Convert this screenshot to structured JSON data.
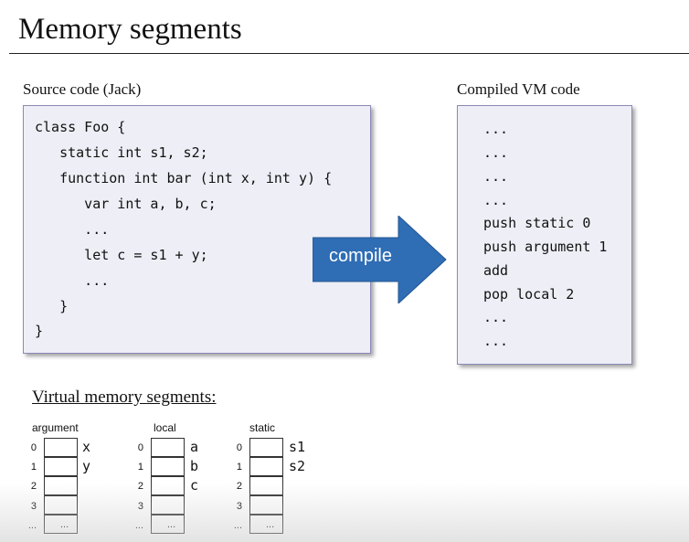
{
  "title": "Memory segments",
  "source": {
    "label": "Source code (Jack)",
    "lines": [
      "class Foo {",
      "   static int s1, s2;",
      "   function int bar (int x, int y) {",
      "      var int a, b, c;",
      "      ...",
      "      let c = s1 + y;",
      "      ...",
      "   }",
      "}"
    ]
  },
  "compile_label": "compile",
  "compiled": {
    "label": "Compiled VM code",
    "lines": [
      "...",
      "...",
      "...",
      "...",
      "push static 0",
      "push argument 1",
      "add",
      "pop local 2",
      "...",
      "..."
    ]
  },
  "virtual_heading": "Virtual memory segments:",
  "segments": [
    {
      "name": "argument",
      "indices": [
        "0",
        "1",
        "2",
        "3",
        "..."
      ],
      "cell_text": [
        "",
        "",
        "",
        "",
        "..."
      ],
      "vars": [
        "x",
        "y"
      ]
    },
    {
      "name": "local",
      "indices": [
        "0",
        "1",
        "2",
        "3",
        "..."
      ],
      "cell_text": [
        "",
        "",
        "",
        "",
        "..."
      ],
      "vars": [
        "a",
        "b",
        "c"
      ]
    },
    {
      "name": "static",
      "indices": [
        "0",
        "1",
        "2",
        "3",
        "..."
      ],
      "cell_text": [
        "",
        "",
        "",
        "",
        "..."
      ],
      "vars": [
        "s1",
        "s2"
      ]
    }
  ],
  "colors": {
    "arrow": "#2f6db5",
    "box_fill": "#eeeef6",
    "box_border": "#8a8ab8"
  }
}
